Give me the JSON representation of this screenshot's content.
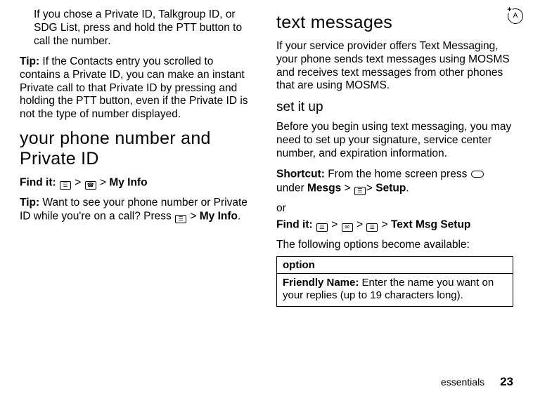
{
  "left": {
    "paragraph1": "If you chose a Private ID, Talkgroup ID, or SDG List, press and hold the PTT button to call the number.",
    "tip_label": "Tip:",
    "tip_text": " If the Contacts entry you scrolled to contains a Private ID, you can make an instant Private call to that Private ID by pressing and holding the PTT button, even if the Private ID is not the type of number displayed.",
    "heading": "your phone number and Private ID",
    "find_it_label": "Find it:",
    "menu_myinfo": "My Info",
    "tip2_label": "Tip:",
    "tip2_text_a": " Want to see your phone number or Private ID while you're on a call? Press ",
    "tip2_text_b": "My Info",
    "tip2_text_c": "."
  },
  "right": {
    "heading": "text messages",
    "paragraph1": "If your service provider offers Text Messaging, your phone sends text messages using MOSMS and receives text messages from other phones that are using MOSMS.",
    "subheading": "set it up",
    "paragraph2": "Before you begin using text messaging, you may need to set up your signature, service center number, and expiration information.",
    "shortcut_label": "Shortcut:",
    "shortcut_text_a": " From the home screen press ",
    "shortcut_text_b": " under ",
    "mesgs": "Mesgs",
    "setup": "Setup",
    "shortcut_text_c": ".",
    "or": "or",
    "find_it_label": "Find it:",
    "textmsgsetup": "Text Msg Setup",
    "paragraph3": "The following options become available:",
    "option_header": "option",
    "friendly_label": "Friendly Name:",
    "friendly_text": " Enter the name you want on your replies (up to 19 characters long)."
  },
  "footer": {
    "label": "essentials",
    "page": "23"
  },
  "icon_feature_label": "A"
}
